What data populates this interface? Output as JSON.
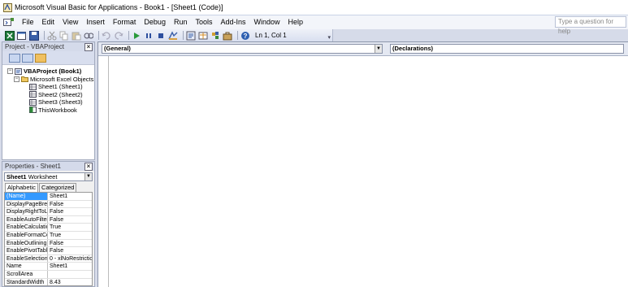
{
  "window": {
    "title": "Microsoft Visual Basic for Applications - Book1 - [Sheet1 (Code)]"
  },
  "menu": {
    "items": [
      "File",
      "Edit",
      "View",
      "Insert",
      "Format",
      "Debug",
      "Run",
      "Tools",
      "Add-Ins",
      "Window",
      "Help"
    ],
    "help_placeholder": "Type a question for help"
  },
  "toolbar": {
    "position": "Ln 1, Col 1",
    "icons": [
      "excel-icon",
      "insert-userform-icon",
      "save-icon",
      "cut-icon",
      "copy-icon",
      "paste-icon",
      "find-icon",
      "undo-icon",
      "redo-icon",
      "run-icon",
      "break-icon",
      "reset-icon",
      "design-mode-icon",
      "project-explorer-icon",
      "properties-icon",
      "object-browser-icon",
      "toolbox-icon",
      "help-icon"
    ]
  },
  "project": {
    "header": "Project - VBAProject",
    "tree": [
      {
        "label": "VBAProject (Book1)",
        "level": 0,
        "bold": true,
        "icon": "project-icon",
        "expander": "-"
      },
      {
        "label": "Microsoft Excel Objects",
        "level": 1,
        "bold": false,
        "icon": "folder-icon",
        "expander": "-"
      },
      {
        "label": "Sheet1 (Sheet1)",
        "level": 2,
        "bold": false,
        "icon": "worksheet-icon",
        "expander": ""
      },
      {
        "label": "Sheet2 (Sheet2)",
        "level": 2,
        "bold": false,
        "icon": "worksheet-icon",
        "expander": ""
      },
      {
        "label": "Sheet3 (Sheet3)",
        "level": 2,
        "bold": false,
        "icon": "worksheet-icon",
        "expander": ""
      },
      {
        "label": "ThisWorkbook",
        "level": 2,
        "bold": false,
        "icon": "workbook-icon",
        "expander": ""
      }
    ]
  },
  "properties": {
    "header": "Properties - Sheet1",
    "object_name": "Sheet1",
    "object_type": "Worksheet",
    "tabs": [
      "Alphabetic",
      "Categorized"
    ],
    "rows": [
      {
        "name": "(Name)",
        "value": "Sheet1"
      },
      {
        "name": "DisplayPageBreak",
        "value": "False"
      },
      {
        "name": "DisplayRightToLeft",
        "value": "False"
      },
      {
        "name": "EnableAutoFilter",
        "value": "False"
      },
      {
        "name": "EnableCalculation",
        "value": "True"
      },
      {
        "name": "EnableFormatCon",
        "value": "True"
      },
      {
        "name": "EnableOutlining",
        "value": "False"
      },
      {
        "name": "EnablePivotTable",
        "value": "False"
      },
      {
        "name": "EnableSelection",
        "value": "0 - xlNoRestrictio"
      },
      {
        "name": "Name",
        "value": "Sheet1"
      },
      {
        "name": "ScrollArea",
        "value": ""
      },
      {
        "name": "StandardWidth",
        "value": "8.43"
      }
    ]
  },
  "code": {
    "object_combo": "(General)",
    "procedure_combo": "(Declarations)"
  }
}
